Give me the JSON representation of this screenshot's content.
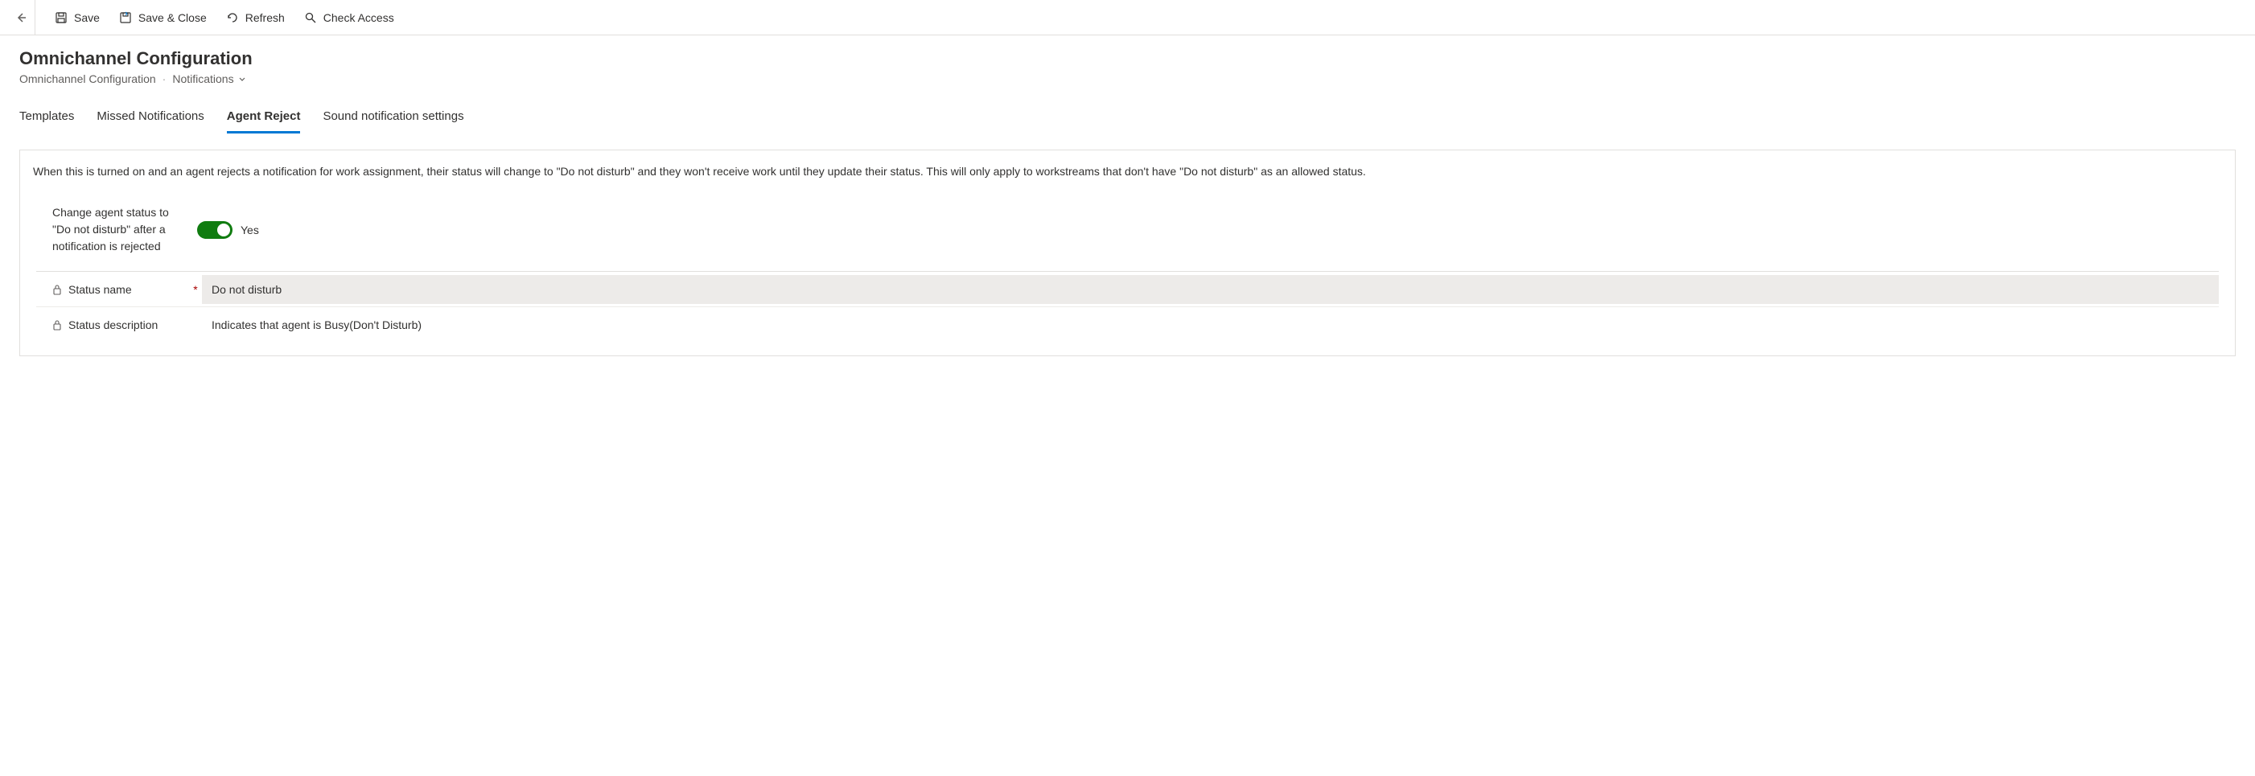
{
  "commandBar": {
    "save": "Save",
    "saveClose": "Save & Close",
    "refresh": "Refresh",
    "checkAccess": "Check Access"
  },
  "header": {
    "title": "Omnichannel Configuration",
    "breadcrumb1": "Omnichannel Configuration",
    "breadcrumb2": "Notifications"
  },
  "tabs": {
    "templates": "Templates",
    "missed": "Missed Notifications",
    "agentReject": "Agent Reject",
    "sound": "Sound notification settings"
  },
  "panel": {
    "description": "When this is turned on and an agent rejects a notification for work assignment, their status will change to \"Do not disturb\" and they won't receive work until they update their status. This will only apply to workstreams that don't have \"Do not disturb\" as an allowed status.",
    "toggleLabel": "Change agent status to \"Do not disturb\" after a notification is rejected",
    "toggleValue": "Yes",
    "fields": {
      "statusName": {
        "label": "Status name",
        "value": "Do not disturb"
      },
      "statusDescription": {
        "label": "Status description",
        "value": "Indicates that agent is Busy(Don't Disturb)"
      }
    }
  }
}
